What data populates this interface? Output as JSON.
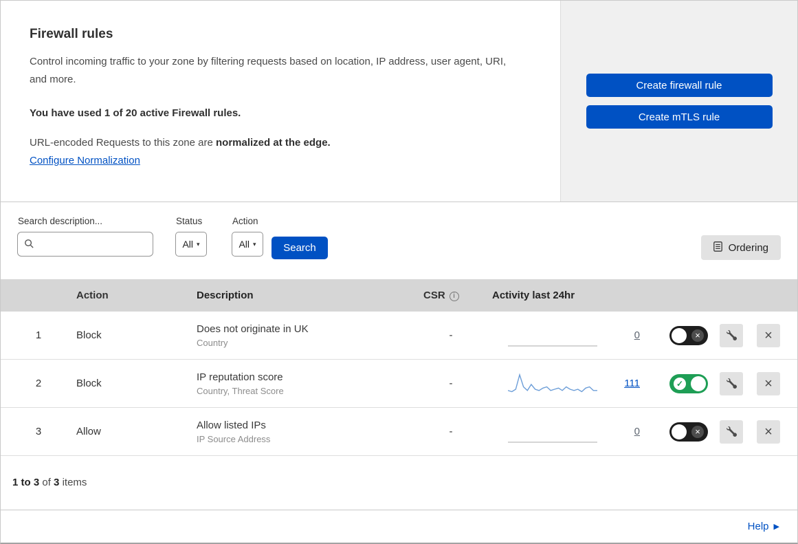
{
  "header": {
    "title": "Firewall rules",
    "description": "Control incoming traffic to your zone by filtering requests based on location, IP address, user agent, URI, and more.",
    "usage_text": "You have used 1 of 20 active Firewall rules.",
    "normalization_text": "URL-encoded Requests to this zone are ",
    "normalization_bold": "normalized at the edge.",
    "normalization_link": "Configure Normalization",
    "create_firewall_button": "Create firewall rule",
    "create_mtls_button": "Create mTLS rule"
  },
  "toolbar": {
    "search_label": "Search description...",
    "status_label": "Status",
    "status_value": "All",
    "action_label": "Action",
    "action_value": "All",
    "search_button": "Search",
    "ordering_button": "Ordering"
  },
  "table": {
    "headers": {
      "action": "Action",
      "description": "Description",
      "csr": "CSR",
      "activity": "Activity last 24hr"
    },
    "rows": [
      {
        "priority": "1",
        "action": "Block",
        "description": "Does not originate in UK",
        "criteria": "Country",
        "csr": "-",
        "activity_count": "0",
        "enabled": false,
        "sparkline": [
          0,
          0,
          0,
          0,
          0,
          0,
          0,
          0,
          0,
          0,
          0,
          0
        ]
      },
      {
        "priority": "2",
        "action": "Block",
        "description": "IP reputation score",
        "criteria": "Country, Threat Score",
        "csr": "-",
        "activity_count": "111",
        "enabled": true,
        "sparkline": [
          3,
          2,
          4,
          16,
          6,
          3,
          8,
          4,
          3,
          5,
          6,
          3,
          4,
          5,
          3,
          6,
          4,
          3,
          4,
          2,
          5,
          6,
          3,
          3
        ]
      },
      {
        "priority": "3",
        "action": "Allow",
        "description": "Allow listed IPs",
        "criteria": "IP Source Address",
        "csr": "-",
        "activity_count": "0",
        "enabled": false,
        "sparkline": [
          0,
          0,
          0,
          0,
          0,
          0,
          0,
          0,
          0,
          0,
          0,
          0
        ]
      }
    ]
  },
  "footer": {
    "range": "1 to 3",
    "of_text": "of",
    "total": "3",
    "items_text": "items",
    "help": "Help"
  },
  "colors": {
    "primary_blue": "#0051c3",
    "toggle_on_green": "#1e9e55",
    "sparkline_blue": "#6d9ed8",
    "sparkline_flat": "#c7c7c7"
  }
}
